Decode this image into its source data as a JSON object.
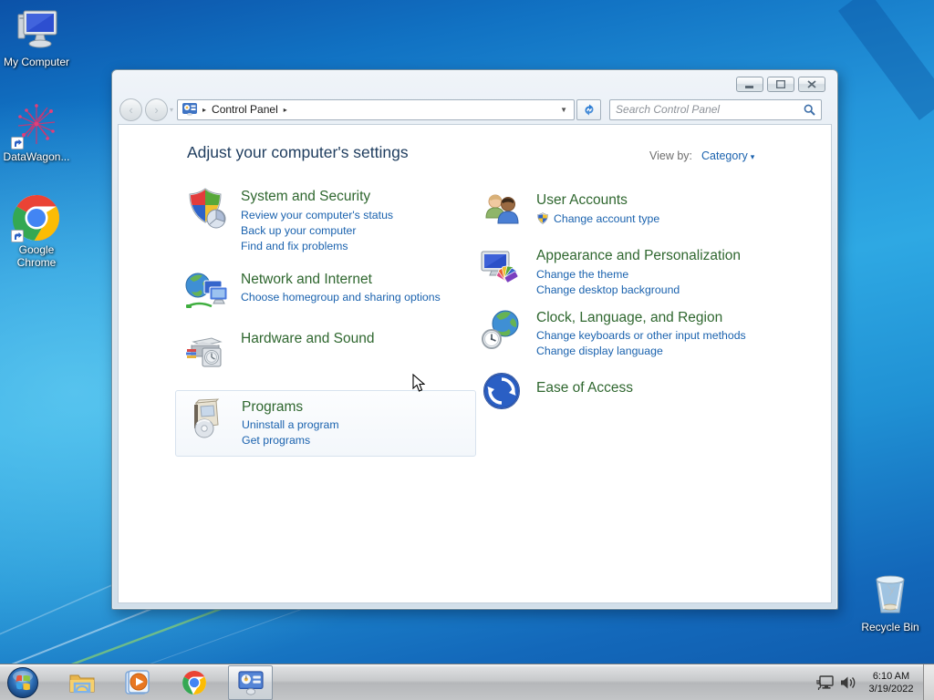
{
  "icons": {
    "breadcrumb_arrow": "▸",
    "address_dropdown": "▼",
    "view_dropdown": "▾",
    "nav_chevron": "▾",
    "back_glyph": "‹",
    "forward_glyph": "›"
  },
  "desktop": {
    "icons": [
      {
        "label": "My Computer"
      },
      {
        "label": "DataWagon..."
      },
      {
        "label": "Google Chrome"
      },
      {
        "label": "Recycle Bin"
      }
    ]
  },
  "window": {
    "nav": {
      "breadcrumb_root": "Control Panel"
    },
    "search": {
      "placeholder": "Search Control Panel"
    },
    "content": {
      "heading": "Adjust your computer's settings",
      "view_by_label": "View by:",
      "view_by_value": "Category",
      "categories_left": [
        {
          "title": "System and Security",
          "links": [
            "Review your computer's status",
            "Back up your computer",
            "Find and fix problems"
          ]
        },
        {
          "title": "Network and Internet",
          "links": [
            "Choose homegroup and sharing options"
          ]
        },
        {
          "title": "Hardware and Sound",
          "links": []
        },
        {
          "title": "Programs",
          "links": [
            "Uninstall a program",
            "Get programs"
          ]
        }
      ],
      "categories_right": [
        {
          "title": "User Accounts",
          "links": [
            "Change account type"
          ]
        },
        {
          "title": "Appearance and Personalization",
          "links": [
            "Change the theme",
            "Change desktop background"
          ]
        },
        {
          "title": "Clock, Language, and Region",
          "links": [
            "Change keyboards or other input methods",
            "Change display language"
          ]
        },
        {
          "title": "Ease of Access",
          "links": []
        }
      ]
    }
  },
  "taskbar": {
    "clock": {
      "time": "6:10 AM",
      "date": "3/19/2022"
    }
  },
  "colors": {
    "category_title": "#2f672f",
    "task_link": "#1a62ae",
    "page_heading": "#1e3c5e",
    "wallpaper_top": "#0c52a8",
    "wallpaper_bright": "#2ea8e3",
    "taskbar_gray": "#c1c3c5"
  }
}
